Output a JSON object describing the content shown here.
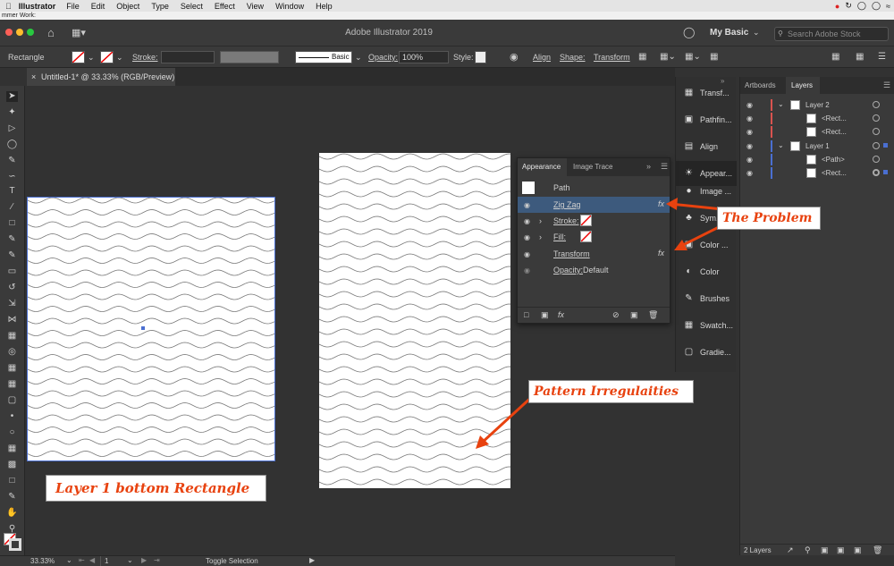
{
  "menubar": {
    "app": "Illustrator",
    "items": [
      "File",
      "Edit",
      "Object",
      "Type",
      "Select",
      "Effect",
      "View",
      "Window",
      "Help"
    ]
  },
  "previous_bar_text": "mmer Work:",
  "window": {
    "title": "Adobe Illustrator 2019",
    "workspace": "My Basic",
    "search_placeholder": "Search Adobe Stock"
  },
  "control_bar": {
    "object_type": "Rectangle",
    "stroke_label": "Stroke:",
    "brush": "Basic",
    "opacity_label": "Opacity:",
    "opacity_value": "100%",
    "style_label": "Style:",
    "align": "Align",
    "shape": "Shape:",
    "transform": "Transform"
  },
  "document_tab": {
    "label": "Untitled-1* @ 33.33% (RGB/Preview)"
  },
  "status_bar": {
    "zoom": "33.33%",
    "artboard": "1",
    "info": "Toggle Selection"
  },
  "dock": {
    "items": [
      {
        "label": "Transf...",
        "icon": "transform-icon"
      },
      {
        "label": "Pathfin...",
        "icon": "pathfinder-icon"
      },
      {
        "label": "Align",
        "icon": "align-icon"
      },
      {
        "label": "Appear...",
        "icon": "appearance-icon"
      },
      {
        "label": "Image ...",
        "icon": "image-trace-icon"
      },
      {
        "label": "Sym...",
        "icon": "symbols-icon"
      },
      {
        "label": "Color ...",
        "icon": "color-guide-icon"
      },
      {
        "label": "Color",
        "icon": "color-icon"
      },
      {
        "label": "Brushes",
        "icon": "brushes-icon"
      },
      {
        "label": "Swatch...",
        "icon": "swatches-icon"
      },
      {
        "label": "Gradie...",
        "icon": "gradient-icon"
      }
    ]
  },
  "appearance": {
    "tab_active": "Appearance",
    "tab_other": "Image Trace",
    "path_label": "Path",
    "rows": {
      "zigzag": "Zig Zag",
      "stroke": "Stroke:",
      "fill": "Fill:",
      "transform": "Transform",
      "opacity_label": "Opacity:",
      "opacity_value": "Default"
    },
    "fx_symbol": "fx"
  },
  "layers": {
    "tab_artboards": "Artboards",
    "tab_layers": "Layers",
    "rows": [
      "Layer 2",
      "<Rect...",
      "<Rect...",
      "Layer 1",
      "<Path>",
      "<Rect..."
    ],
    "footer": "2 Layers"
  },
  "annotations": {
    "problem": "The Problem",
    "irregularities": "Pattern Irregulaities",
    "bottom": "Layer 1 bottom Rectangle"
  },
  "colors": {
    "accent_red": "#e8420f",
    "layer2": "#d9534f",
    "layer1": "#4a6fd1",
    "selection": "#4a6fd1"
  }
}
